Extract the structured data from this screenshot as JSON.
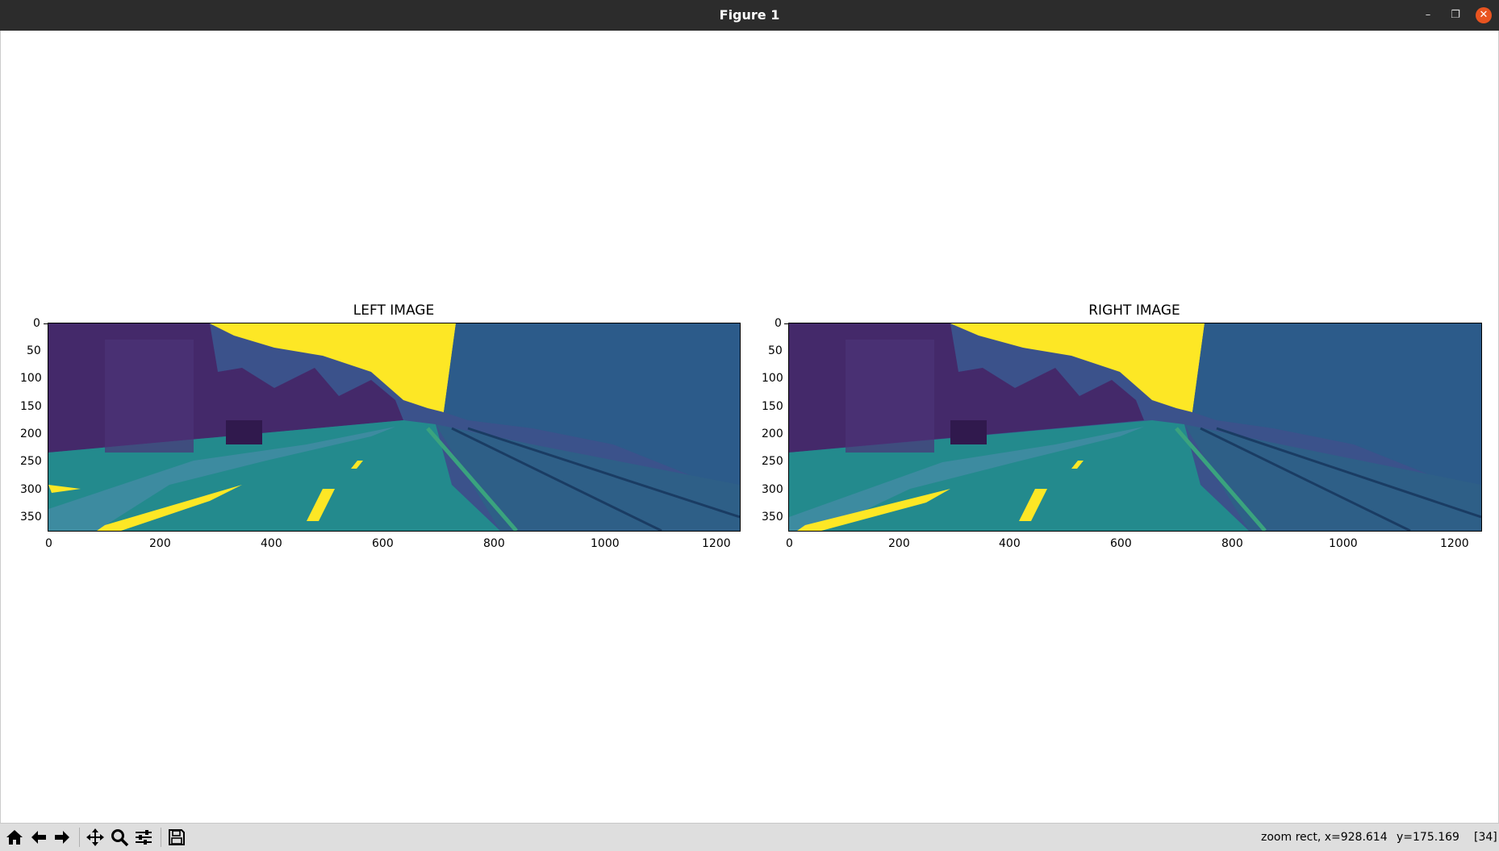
{
  "window": {
    "title": "Figure 1",
    "controls": {
      "minimize": "–",
      "maximize": "❐",
      "close": "✕"
    }
  },
  "figure": {
    "axes": [
      {
        "title": "LEFT IMAGE",
        "x_ticks": [
          "0",
          "200",
          "400",
          "600",
          "800",
          "1000",
          "1200"
        ],
        "y_ticks": [
          "0",
          "50",
          "100",
          "150",
          "200",
          "250",
          "300",
          "350"
        ]
      },
      {
        "title": "RIGHT IMAGE",
        "x_ticks": [
          "0",
          "200",
          "400",
          "600",
          "800",
          "1000",
          "1200"
        ],
        "y_ticks": [
          "0",
          "50",
          "100",
          "150",
          "200",
          "250",
          "300",
          "350"
        ]
      }
    ],
    "colormap": {
      "low": "#440154",
      "mid": "#21918c",
      "high": "#fde725"
    }
  },
  "toolbar": {
    "buttons": [
      {
        "name": "home-icon"
      },
      {
        "name": "back-arrow-icon"
      },
      {
        "name": "forward-arrow-icon"
      },
      {
        "name": "pan-move-icon"
      },
      {
        "name": "zoom-magnifier-icon"
      },
      {
        "name": "configure-subplots-icon"
      },
      {
        "name": "save-floppy-icon"
      }
    ],
    "status_mode": "zoom rect, x=928.614",
    "status_y": "y=175.169",
    "status_value": "[34]"
  }
}
